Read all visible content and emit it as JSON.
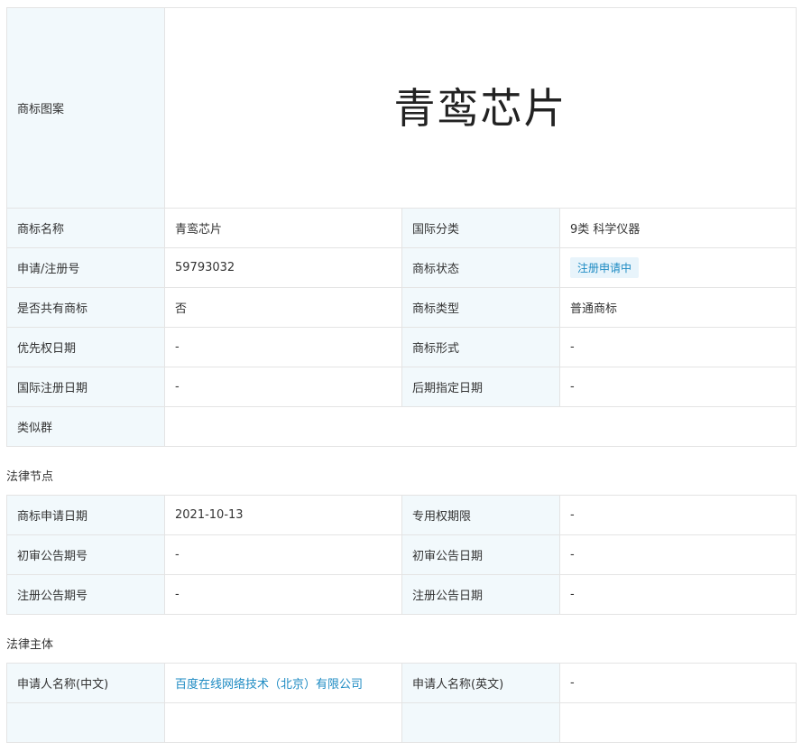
{
  "basic": {
    "image_label": "商标图案",
    "logo_text": "青鸾芯片",
    "rows": [
      {
        "l1": "商标名称",
        "v1": "青鸾芯片",
        "l2": "国际分类",
        "v2": "9类 科学仪器"
      },
      {
        "l1": "申请/注册号",
        "v1": "59793032",
        "l2": "商标状态",
        "v2": "注册申请中"
      },
      {
        "l1": "是否共有商标",
        "v1": "否",
        "l2": "商标类型",
        "v2": "普通商标"
      },
      {
        "l1": "优先权日期",
        "v1": "-",
        "l2": "商标形式",
        "v2": "-"
      },
      {
        "l1": "国际注册日期",
        "v1": "-",
        "l2": "后期指定日期",
        "v2": "-"
      }
    ],
    "similar_group_label": "类似群",
    "similar_group_value": ""
  },
  "legal_nodes": {
    "title": "法律节点",
    "rows": [
      {
        "l1": "商标申请日期",
        "v1": "2021-10-13",
        "l2": "专用权期限",
        "v2": "-"
      },
      {
        "l1": "初审公告期号",
        "v1": "-",
        "l2": "初审公告日期",
        "v2": "-"
      },
      {
        "l1": "注册公告期号",
        "v1": "-",
        "l2": "注册公告日期",
        "v2": "-"
      }
    ]
  },
  "legal_subject": {
    "title": "法律主体",
    "rows": [
      {
        "l1": "申请人名称(中文)",
        "v1": "百度在线网络技术（北京）有限公司",
        "l2": "申请人名称(英文)",
        "v2": "-"
      }
    ]
  },
  "colors": {
    "label_bg": "#f2f9fc",
    "border": "#e4e4e4",
    "link": "#1e8bc3",
    "badge_bg": "#e8f4fb"
  }
}
